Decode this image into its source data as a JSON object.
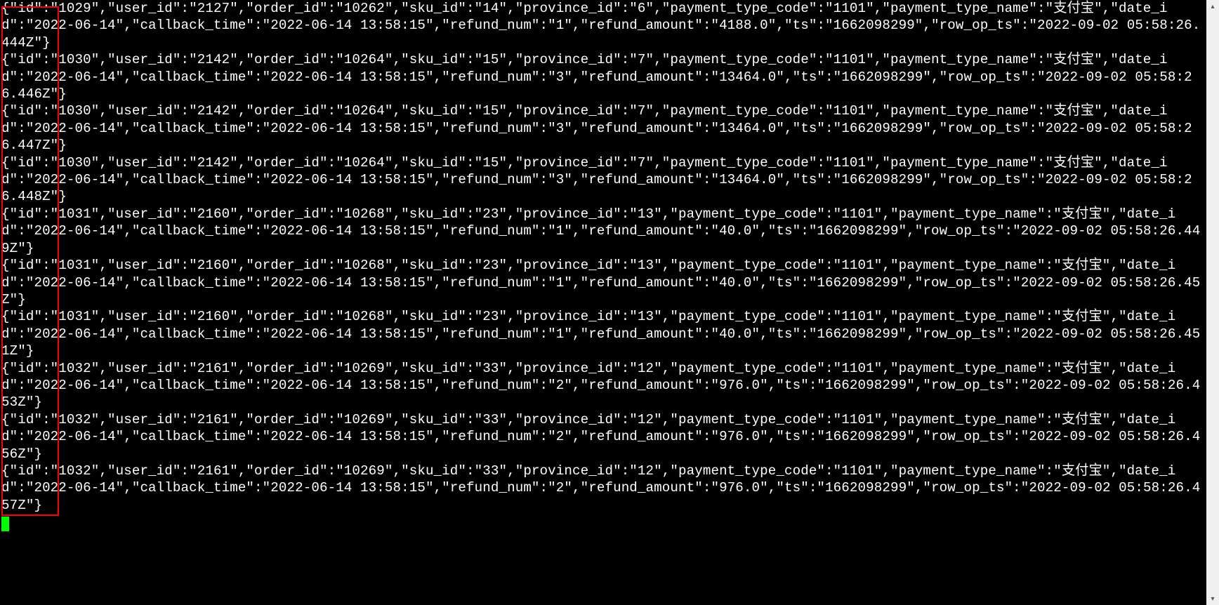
{
  "terminal": {
    "records": [
      {
        "id": "1029",
        "user_id": "2127",
        "order_id": "10262",
        "sku_id": "14",
        "province_id": "6",
        "payment_type_code": "1101",
        "payment_type_name": "支付宝",
        "date_id": "2022-06-14",
        "callback_time": "2022-06-14 13:58:15",
        "refund_num": "1",
        "refund_amount": "4188.0",
        "ts": "1662098299",
        "row_op_ts": "2022-09-02 05:58:26.444Z"
      },
      {
        "id": "1030",
        "user_id": "2142",
        "order_id": "10264",
        "sku_id": "15",
        "province_id": "7",
        "payment_type_code": "1101",
        "payment_type_name": "支付宝",
        "date_id": "2022-06-14",
        "callback_time": "2022-06-14 13:58:15",
        "refund_num": "3",
        "refund_amount": "13464.0",
        "ts": "1662098299",
        "row_op_ts": "2022-09-02 05:58:26.446Z"
      },
      {
        "id": "1030",
        "user_id": "2142",
        "order_id": "10264",
        "sku_id": "15",
        "province_id": "7",
        "payment_type_code": "1101",
        "payment_type_name": "支付宝",
        "date_id": "2022-06-14",
        "callback_time": "2022-06-14 13:58:15",
        "refund_num": "3",
        "refund_amount": "13464.0",
        "ts": "1662098299",
        "row_op_ts": "2022-09-02 05:58:26.447Z"
      },
      {
        "id": "1030",
        "user_id": "2142",
        "order_id": "10264",
        "sku_id": "15",
        "province_id": "7",
        "payment_type_code": "1101",
        "payment_type_name": "支付宝",
        "date_id": "2022-06-14",
        "callback_time": "2022-06-14 13:58:15",
        "refund_num": "3",
        "refund_amount": "13464.0",
        "ts": "1662098299",
        "row_op_ts": "2022-09-02 05:58:26.448Z"
      },
      {
        "id": "1031",
        "user_id": "2160",
        "order_id": "10268",
        "sku_id": "23",
        "province_id": "13",
        "payment_type_code": "1101",
        "payment_type_name": "支付宝",
        "date_id": "2022-06-14",
        "callback_time": "2022-06-14 13:58:15",
        "refund_num": "1",
        "refund_amount": "40.0",
        "ts": "1662098299",
        "row_op_ts": "2022-09-02 05:58:26.449Z"
      },
      {
        "id": "1031",
        "user_id": "2160",
        "order_id": "10268",
        "sku_id": "23",
        "province_id": "13",
        "payment_type_code": "1101",
        "payment_type_name": "支付宝",
        "date_id": "2022-06-14",
        "callback_time": "2022-06-14 13:58:15",
        "refund_num": "1",
        "refund_amount": "40.0",
        "ts": "1662098299",
        "row_op_ts": "2022-09-02 05:58:26.45Z"
      },
      {
        "id": "1031",
        "user_id": "2160",
        "order_id": "10268",
        "sku_id": "23",
        "province_id": "13",
        "payment_type_code": "1101",
        "payment_type_name": "支付宝",
        "date_id": "2022-06-14",
        "callback_time": "2022-06-14 13:58:15",
        "refund_num": "1",
        "refund_amount": "40.0",
        "ts": "1662098299",
        "row_op_ts": "2022-09-02 05:58:26.451Z"
      },
      {
        "id": "1032",
        "user_id": "2161",
        "order_id": "10269",
        "sku_id": "33",
        "province_id": "12",
        "payment_type_code": "1101",
        "payment_type_name": "支付宝",
        "date_id": "2022-06-14",
        "callback_time": "2022-06-14 13:58:15",
        "refund_num": "2",
        "refund_amount": "976.0",
        "ts": "1662098299",
        "row_op_ts": "2022-09-02 05:58:26.453Z"
      },
      {
        "id": "1032",
        "user_id": "2161",
        "order_id": "10269",
        "sku_id": "33",
        "province_id": "12",
        "payment_type_code": "1101",
        "payment_type_name": "支付宝",
        "date_id": "2022-06-14",
        "callback_time": "2022-06-14 13:58:15",
        "refund_num": "2",
        "refund_amount": "976.0",
        "ts": "1662098299",
        "row_op_ts": "2022-09-02 05:58:26.456Z"
      },
      {
        "id": "1032",
        "user_id": "2161",
        "order_id": "10269",
        "sku_id": "33",
        "province_id": "12",
        "payment_type_code": "1101",
        "payment_type_name": "支付宝",
        "date_id": "2022-06-14",
        "callback_time": "2022-06-14 13:58:15",
        "refund_num": "2",
        "refund_amount": "976.0",
        "ts": "1662098299",
        "row_op_ts": "2022-09-02 05:58:26.457Z"
      }
    ],
    "field_order": [
      "id",
      "user_id",
      "order_id",
      "sku_id",
      "province_id",
      "payment_type_code",
      "payment_type_name",
      "date_id",
      "callback_time",
      "refund_num",
      "refund_amount",
      "ts",
      "row_op_ts"
    ]
  },
  "annotation": {
    "highlight_box_label": "id-column-highlight"
  },
  "scrollbar": {
    "arrow_up": "▴",
    "arrow_down": "▾"
  }
}
